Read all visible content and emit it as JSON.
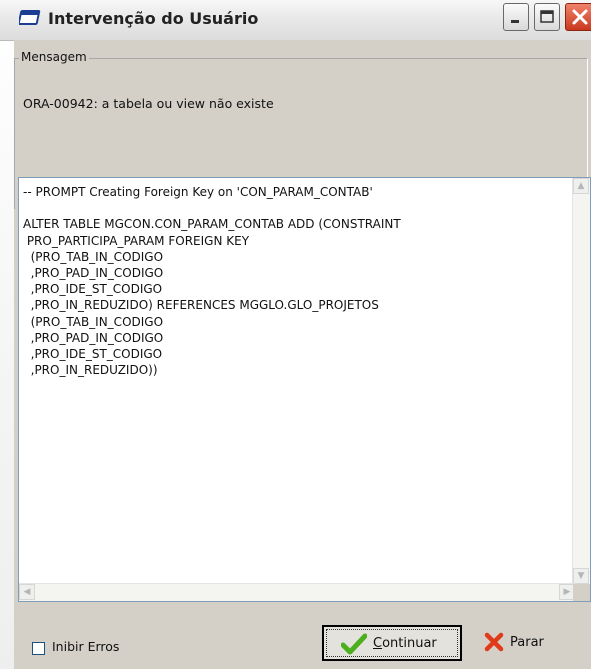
{
  "window": {
    "title": "Intervenção do Usuário",
    "icon": "application-window-icon",
    "controls": [
      "minimize-icon",
      "maximize-icon",
      "close-icon"
    ]
  },
  "message_group": {
    "legend": "Mensagem",
    "text": "ORA-00942: a tabela ou view não existe"
  },
  "sql_text": "-- PROMPT Creating Foreign Key on 'CON_PARAM_CONTAB'\n\nALTER TABLE MGCON.CON_PARAM_CONTAB ADD (CONSTRAINT\n PRO_PARTICIPA_PARAM FOREIGN KEY\n  (PRO_TAB_IN_CODIGO\n  ,PRO_PAD_IN_CODIGO\n  ,PRO_IDE_ST_CODIGO\n  ,PRO_IN_REDUZIDO) REFERENCES MGGLO.GLO_PROJETOS\n  (PRO_TAB_IN_CODIGO\n  ,PRO_PAD_IN_CODIGO\n  ,PRO_IDE_ST_CODIGO\n  ,PRO_IN_REDUZIDO))",
  "footer": {
    "inhibit_errors_label": "Inibir Erros",
    "inhibit_errors_checked": false,
    "continue_label_rest": "ontinuar",
    "continue_label_mnemonic": "C",
    "stop_label": "Parar"
  },
  "colors": {
    "dialog_bg": "#d4d0c8",
    "editor_border": "#7f9db9",
    "continue_icon": "#4caf1e",
    "stop_icon": "#e03a1a"
  }
}
